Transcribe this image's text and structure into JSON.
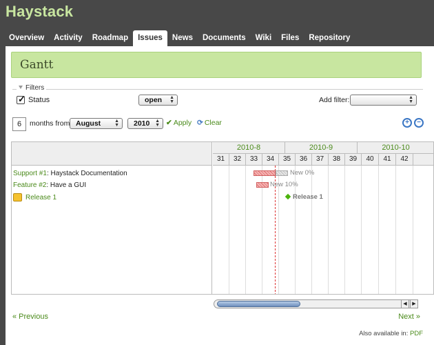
{
  "app": {
    "title": "Haystack"
  },
  "tabs": [
    {
      "label": "Overview",
      "active": false
    },
    {
      "label": "Activity",
      "active": false
    },
    {
      "label": "Roadmap",
      "active": false
    },
    {
      "label": "Issues",
      "active": true
    },
    {
      "label": "News",
      "active": false
    },
    {
      "label": "Documents",
      "active": false
    },
    {
      "label": "Wiki",
      "active": false
    },
    {
      "label": "Files",
      "active": false
    },
    {
      "label": "Repository",
      "active": false
    }
  ],
  "page": {
    "title": "Gantt"
  },
  "filters": {
    "legend": "Filters",
    "status_label": "Status",
    "status_checked": true,
    "status_value": "open",
    "add_filter_label": "Add filter:",
    "add_filter_value": ""
  },
  "controls": {
    "months": "6",
    "months_from_label": "months from",
    "month_value": "August",
    "year_value": "2010",
    "apply_label": "Apply",
    "clear_label": "Clear"
  },
  "gantt": {
    "months": [
      "2010-8",
      "2010-9",
      "2010-10"
    ],
    "weeks": [
      "31",
      "32",
      "33",
      "34",
      "35",
      "36",
      "37",
      "38",
      "39",
      "40",
      "41",
      "42"
    ],
    "issues": [
      {
        "tracker_link": "Support #1",
        "subject": ": Haystack Documentation",
        "bar_label": "New 0%",
        "done_percent": 0
      },
      {
        "tracker_link": "Feature #2",
        "subject": ": Have a GUI",
        "bar_label": "New 10%",
        "done_percent": 10
      }
    ],
    "version": {
      "name": "Release 1",
      "bar_label": "Release 1"
    }
  },
  "pagination": {
    "previous": "« Previous",
    "next": "Next »"
  },
  "footer": {
    "also_available": "Also available in:",
    "pdf": "PDF"
  },
  "colors": {
    "header_bg": "#484848",
    "accent": "#c8e6a0",
    "link": "#4a8a1a",
    "late": "#e07070",
    "milestone": "#4bb30c"
  }
}
